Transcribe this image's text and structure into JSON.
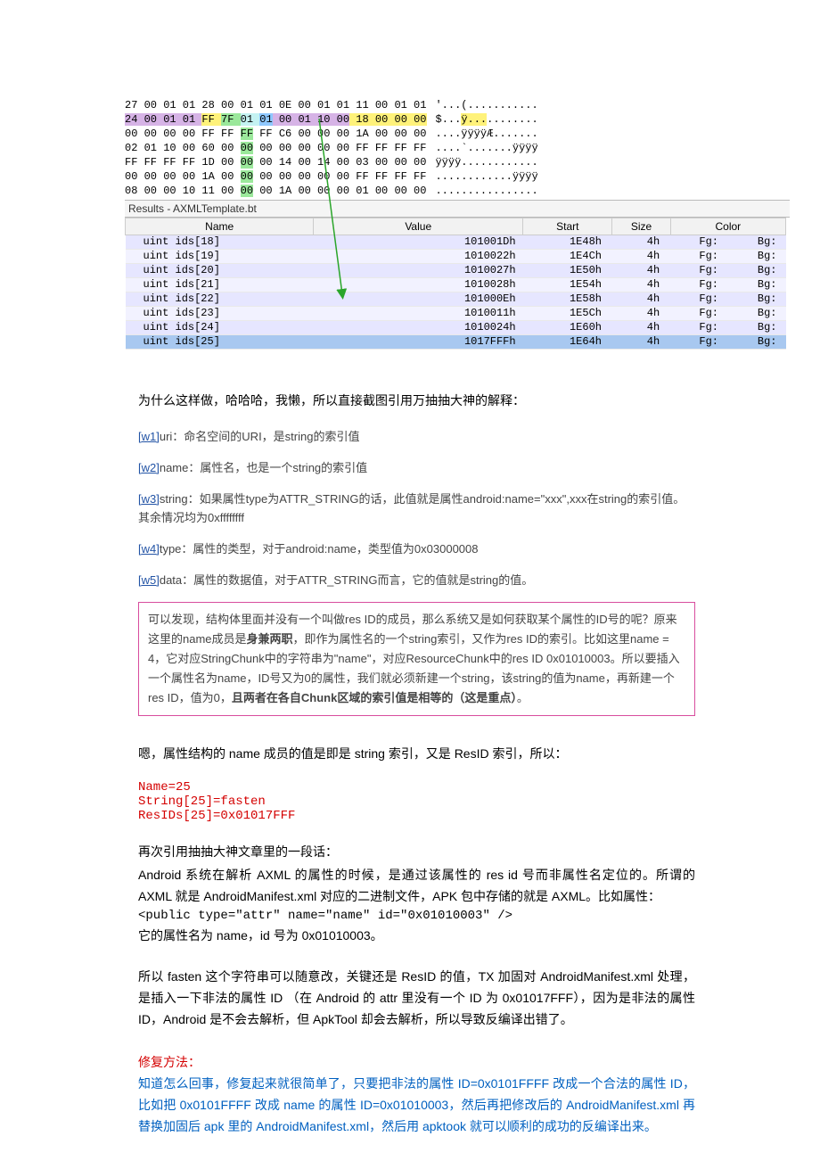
{
  "hex": {
    "rows": [
      {
        "pre": "",
        "bytes": "27 00 01 01 28 00 01 01 0E 00 01 01 11 00 01 01",
        "post": "",
        "ascii": "'...(..........."
      },
      {
        "pre": "24 00 01 01 ",
        "hl": "FF 7F 01 01",
        "seg": [
          {
            "t": "FF ",
            "c": "hl-yellow"
          },
          {
            "t": "7F ",
            "c": "hl-green"
          },
          {
            "t": "01 ",
            "c": "hl-cyan"
          },
          {
            "t": "01",
            "c": "hl-blue"
          }
        ],
        "post": " 00 01 10 00",
        "post2": " 18 00 00 00",
        "ascii": "$...",
        "asciiHL": "ÿ...",
        "asciiPost": "........"
      },
      {
        "pre": "00 00 00 00 FF FF ",
        "mid": "FF",
        "midc": "hl-green",
        "mid2": " FF",
        "post": " C6 00 00 00 1A 00 00 00",
        "ascii": "....ÿÿÿÿÆ......."
      },
      {
        "pre": "02 01 10 00 60 00 ",
        "mid": "00",
        "midc": "hl-green",
        "post": " 00 00 00 00 00 FF FF FF FF",
        "ascii": "....`.......ÿÿÿÿ"
      },
      {
        "pre": "FF FF FF FF 1D 00 ",
        "mid": "00",
        "midc": "hl-green",
        "post": " 00 14 00 14 00 03 00 00 00",
        "ascii": "ÿÿÿÿ............"
      },
      {
        "pre": "00 00 00 00 1A 00 ",
        "mid": "00",
        "midc": "hl-green",
        "post": " 00 00 00 00 00 FF FF FF FF",
        "ascii": "............ÿÿÿÿ"
      },
      {
        "pre": "08 00 00 10 11 00 ",
        "mid": "00",
        "midc": "hl-green",
        "post": " 00 1A 00 00 00 01 00 00 00",
        "ascii": "................"
      }
    ],
    "results_label": "Results - AXMLTemplate.bt",
    "headers": [
      "Name",
      "Value",
      "Start",
      "Size",
      "Color",
      ""
    ],
    "table": [
      {
        "name": "uint ids[18]",
        "value": "101001Dh",
        "start": "1E48h",
        "size": "4h",
        "fg": "Fg:",
        "bg": "Bg:"
      },
      {
        "name": "uint ids[19]",
        "value": "1010022h",
        "start": "1E4Ch",
        "size": "4h",
        "fg": "Fg:",
        "bg": "Bg:"
      },
      {
        "name": "uint ids[20]",
        "value": "1010027h",
        "start": "1E50h",
        "size": "4h",
        "fg": "Fg:",
        "bg": "Bg:"
      },
      {
        "name": "uint ids[21]",
        "value": "1010028h",
        "start": "1E54h",
        "size": "4h",
        "fg": "Fg:",
        "bg": "Bg:"
      },
      {
        "name": "uint ids[22]",
        "value": "101000Eh",
        "start": "1E58h",
        "size": "4h",
        "fg": "Fg:",
        "bg": "Bg:"
      },
      {
        "name": "uint ids[23]",
        "value": "1010011h",
        "start": "1E5Ch",
        "size": "4h",
        "fg": "Fg:",
        "bg": "Bg:"
      },
      {
        "name": "uint ids[24]",
        "value": "1010024h",
        "start": "1E60h",
        "size": "4h",
        "fg": "Fg:",
        "bg": "Bg:"
      },
      {
        "name": "uint ids[25]",
        "value": "1017FFFh",
        "start": "1E64h",
        "size": "4h",
        "fg": "Fg:",
        "bg": "Bg:"
      }
    ]
  },
  "text": {
    "p1": "为什么这样做，哈哈哈，我懒，所以直接截图引用万抽抽大神的解释：",
    "w1": "uri：命名空间的URI，是string的索引值",
    "w2": "name：属性名，也是一个string的索引值",
    "w3": "string：如果属性type为ATTR_STRING的话，此值就是属性android:name=\"xxx\",xxx在string的索引值。其余情况均为0xffffffff",
    "w4": "type：属性的类型，对于android:name，类型值为0x03000008",
    "w5": "data：属性的数据值，对于ATTR_STRING而言，它的值就是string的值。",
    "box": "可以发现，结构体里面并没有一个叫做res ID的成员，那么系统又是如何获取某个属性的ID号的呢？原来这里的name成员是身兼两职，即作为属性名的一个string索引，又作为res ID的索引。比如这里name = 4，它对应StringChunk中的字符串为\"name\"，对应ResourceChunk中的res ID 0x01010003。所以要插入一个属性名为name，ID号又为0的属性，我们就必须新建一个string，该string的值为name，再新建一个res ID，值为0，且两者在各自Chunk区域的索引值是相等的（这是重点）。",
    "p2": "嗯，属性结构的 name 成员的值是即是 string 索引，又是 ResID 索引，所以：",
    "r1": "Name=25",
    "r2": "String[25]=fasten",
    "r3": "ResIDs[25]=0x01017FFF",
    "p3": "再次引用抽抽大神文章里的一段话：",
    "p4": "Android 系统在解析 AXML 的属性的时候，是通过该属性的 res id 号而非属性名定位的。所谓的 AXML 就是 AndroidManifest.xml 对应的二进制文件，APK 包中存储的就是 AXML。比如属性：",
    "p5": "<public type=\"attr\" name=\"name\" id=\"0x01010003\" />",
    "p6": "它的属性名为 name，id 号为 0x01010003。",
    "p7": "所以 fasten 这个字符串可以随意改，关键还是 ResID 的值，TX 加固对 AndroidManifest.xml 处理，是插入一下非法的属性 ID （在 Android 的 attr 里没有一个 ID 为 0x01017FFF），因为是非法的属性 ID，Android 是不会去解析，但 ApkTool 却会去解析，所以导致反编译出错了。",
    "fix_title": "修复方法：",
    "fix_body": "知道怎么回事，修复起来就很简单了，只要把非法的属性 ID=0x0101FFFF 改成一个合法的属性 ID，比如把 0x0101FFFF 改成 name 的属性 ID=0x01010003，然后再把修改后的 AndroidManifest.xml 再替换加固后 apk 里的 AndroidManifest.xml，然后用 apktook 就可以顺利的成功的反编译出来。"
  },
  "labels": {
    "w1": "[w1]",
    "w2": "[w2]",
    "w3": "[w3]",
    "w4": "[w4]",
    "w5": "[w5]",
    "bold1": "身兼两职",
    "bold2": "且两者在各自Chunk区域的索引值是相等的（这是重点）"
  }
}
